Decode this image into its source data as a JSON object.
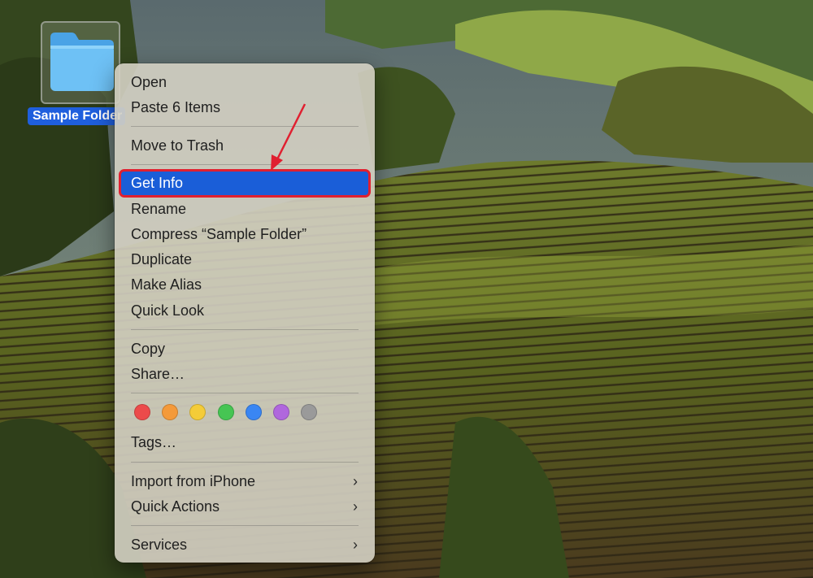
{
  "desktop": {
    "folder_label": "Sample Folder",
    "folder_icon": "folder-icon"
  },
  "context_menu": {
    "open": "Open",
    "paste": "Paste 6 Items",
    "move_to_trash": "Move to Trash",
    "get_info": "Get Info",
    "rename": "Rename",
    "compress": "Compress “Sample Folder”",
    "duplicate": "Duplicate",
    "make_alias": "Make Alias",
    "quick_look": "Quick Look",
    "copy": "Copy",
    "share": "Share…",
    "tags_label": "Tags…",
    "import_from_iphone": "Import from iPhone",
    "quick_actions": "Quick Actions",
    "services": "Services",
    "submenu_glyph": "›",
    "highlighted_item": "Get Info"
  },
  "tag_colors": [
    {
      "name": "red",
      "color": "#ec4b4b"
    },
    {
      "name": "orange",
      "color": "#f49a3a"
    },
    {
      "name": "yellow",
      "color": "#f4cc38"
    },
    {
      "name": "green",
      "color": "#46c553"
    },
    {
      "name": "blue",
      "color": "#3a86f3"
    },
    {
      "name": "purple",
      "color": "#b067dd"
    },
    {
      "name": "gray",
      "color": "#9a9a9a"
    }
  ],
  "colors": {
    "highlight": "#1a5ed8",
    "annotation": "#e02030"
  }
}
